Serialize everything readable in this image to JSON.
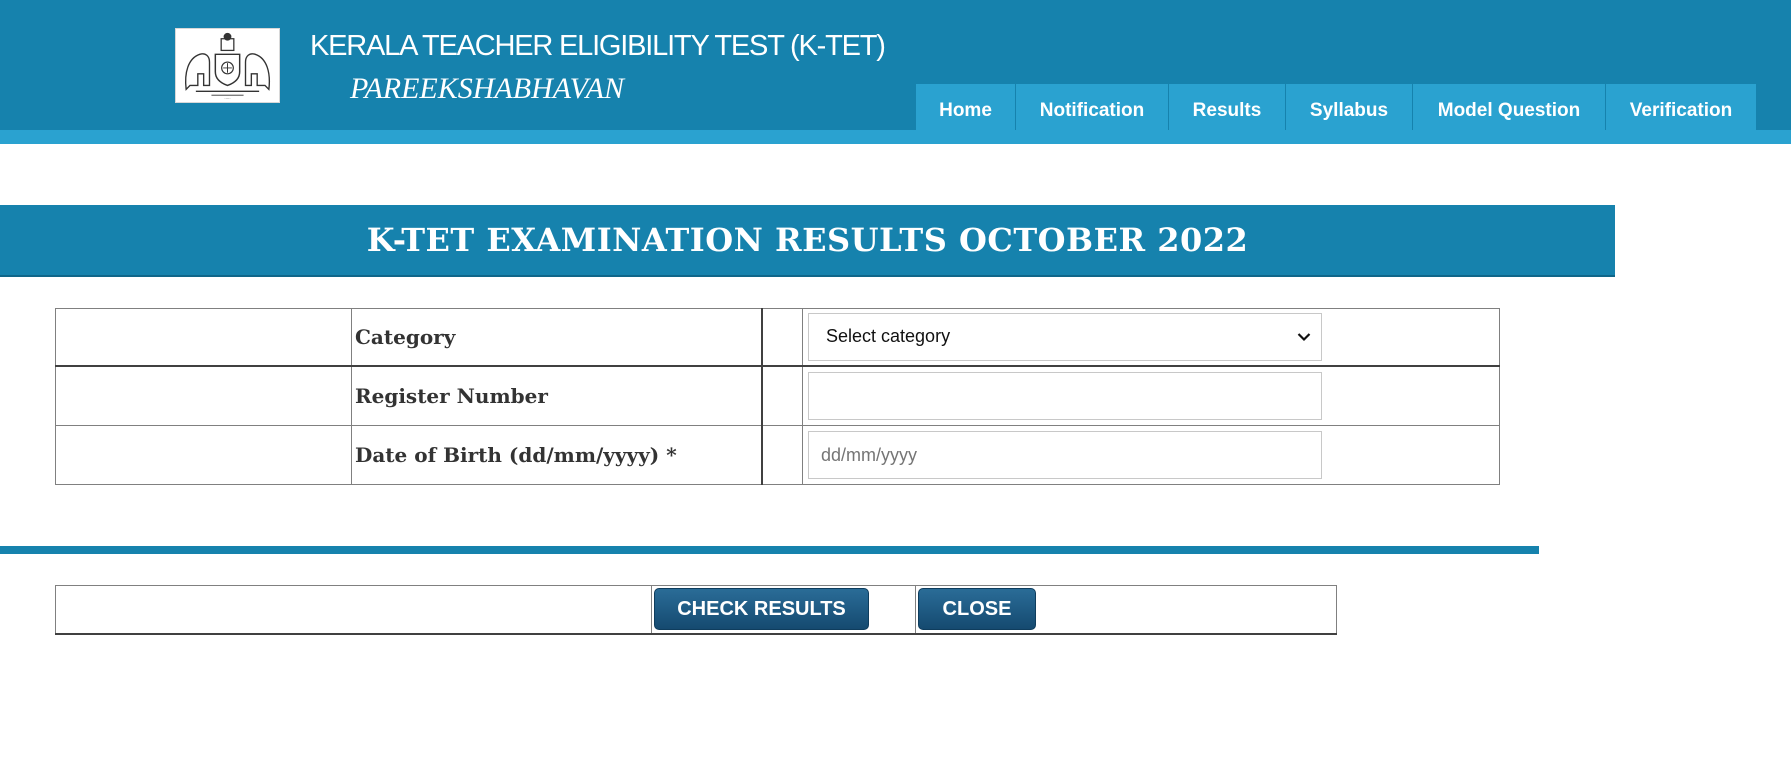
{
  "header": {
    "title": "KERALA TEACHER ELIGIBILITY TEST (K-TET)",
    "subtitle": "PAREEKSHABHAVAN",
    "emblem_icon": "kerala-emblem-icon",
    "background": "#1682ad"
  },
  "nav": {
    "items": [
      {
        "label": "Home"
      },
      {
        "label": "Notification"
      },
      {
        "label": "Results"
      },
      {
        "label": "Syllabus"
      },
      {
        "label": "Model Question"
      },
      {
        "label": "Verification"
      }
    ],
    "background": "#2aa2d0"
  },
  "banner": {
    "title": "K-TET EXAMINATION RESULTS OCTOBER 2022"
  },
  "form": {
    "category_label": "Category",
    "category_selected": "Select category",
    "register_label": "Register Number",
    "register_value": "",
    "dob_label": "Date of Birth (dd/mm/yyyy) *",
    "dob_placeholder": "dd/mm/yyyy"
  },
  "actions": {
    "check_results_label": "CHECK RESULTS",
    "close_label": "CLOSE",
    "button_color": "#1d5c86"
  }
}
